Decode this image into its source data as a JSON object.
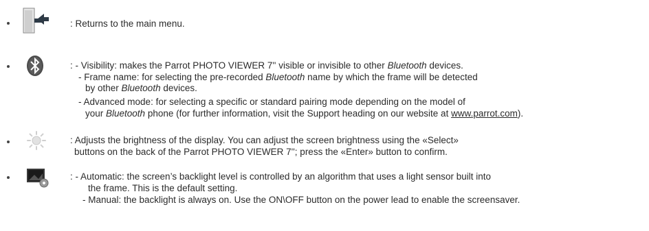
{
  "items": [
    {
      "icon": "exit-door-icon",
      "lines": [
        ": Returns to the main menu."
      ]
    },
    {
      "icon": "bluetooth-icon",
      "line1": {
        "pre": ": - Visibility: makes the Parrot PHOTO VIEWER 7'' visible or invisible to other ",
        "em": "Bluetooth",
        "post": " devices."
      },
      "line2": {
        "pre": "- Frame name: for selecting the pre-recorded ",
        "em": "Bluetooth",
        "post": " name by which the frame will be detected"
      },
      "line3": {
        "pre": "by other ",
        "em": "Bluetooth",
        "post": " devices."
      },
      "line4": "- Advanced mode: for selecting a specific or standard pairing mode depending on the model of",
      "line5": {
        "pre": "your ",
        "em": "Bluetooth",
        "post": " phone (for further information, visit the Support heading on our website at ",
        "link": "www.parrot.com",
        "end": ")."
      }
    },
    {
      "icon": "brightness-sun-icon",
      "lines": [
        ": Adjusts the brightness of the display. You can adjust the screen brightness using the «Select»",
        "buttons on the back of the Parrot PHOTO VIEWER 7''; press the «Enter» button to confirm."
      ]
    },
    {
      "icon": "backlight-settings-icon",
      "lines": [
        ":   - Automatic: the screen’s backlight level is controlled by an algorithm that uses a light sensor built into",
        "the frame. This is the default setting.",
        "- Manual: the backlight is always on. Use the ON\\OFF button on the power lead to enable the screensaver."
      ]
    }
  ]
}
